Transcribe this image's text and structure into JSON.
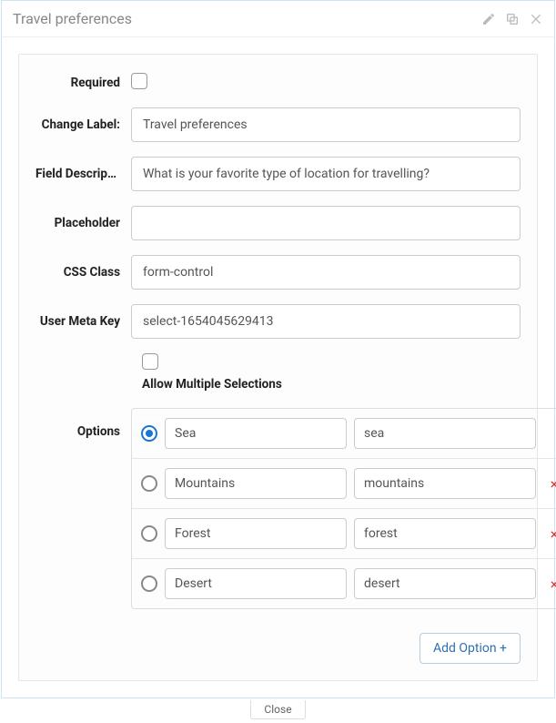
{
  "window": {
    "title": "Travel preferences"
  },
  "form": {
    "required": {
      "label": "Required",
      "checked": false
    },
    "change_label": {
      "label": "Change Label:",
      "value": "Travel preferences"
    },
    "description": {
      "label": "Field Descript...",
      "value": "What is your favorite type of location for travelling?"
    },
    "placeholder": {
      "label": "Placeholder",
      "value": ""
    },
    "css_class": {
      "label": "CSS Class",
      "value": "form-control"
    },
    "meta_key": {
      "label": "User Meta Key",
      "value": "select-1654045629413"
    },
    "allow_multi": {
      "label": "Allow Multiple Selections",
      "checked": false
    },
    "options_label": "Options",
    "options": [
      {
        "selected": true,
        "label": "Sea",
        "value": "sea",
        "removable": false
      },
      {
        "selected": false,
        "label": "Mountains",
        "value": "mountains",
        "removable": true
      },
      {
        "selected": false,
        "label": "Forest",
        "value": "forest",
        "removable": true
      },
      {
        "selected": false,
        "label": "Desert",
        "value": "desert",
        "removable": true
      }
    ],
    "add_option_label": "Add Option +"
  },
  "footer": {
    "close_label": "Close"
  }
}
